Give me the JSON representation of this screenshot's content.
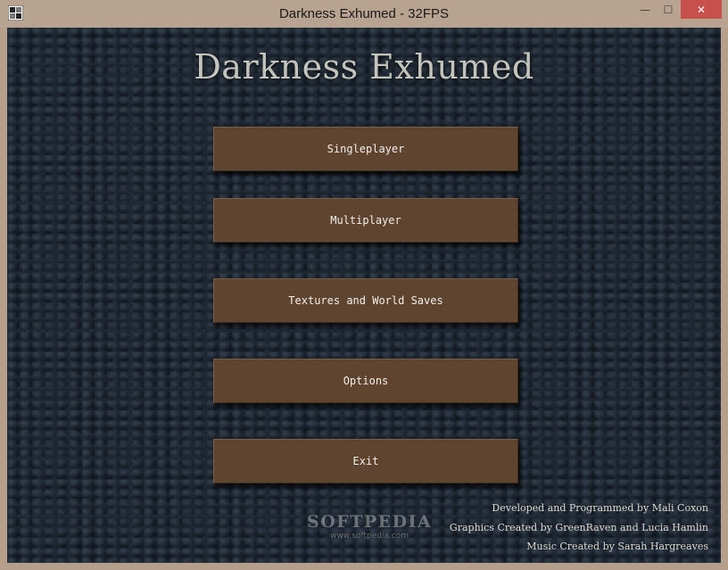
{
  "window": {
    "title": "Darkness Exhumed - 32FPS",
    "minimize_glyph": "—",
    "maximize_glyph": "☐",
    "close_glyph": "✕"
  },
  "game": {
    "title": "Darkness Exhumed"
  },
  "menu": {
    "items": [
      {
        "label": "Singleplayer"
      },
      {
        "label": "Multiplayer"
      },
      {
        "label": "Textures and World Saves"
      },
      {
        "label": "Options"
      },
      {
        "label": "Exit"
      }
    ]
  },
  "credits": {
    "developer": "Developed and Programmed by Mali Coxon",
    "graphics": "Graphics Created by GreenRaven and Lucia Hamlin",
    "music": "Music Created by Sarah Hargreaves"
  },
  "watermark": {
    "brand": "SOFTPEDIA",
    "url": "www.softpedia.com"
  },
  "colors": {
    "button_fill": "#5f4430",
    "title_text": "#c4c4bd",
    "close_button": "#c7504d"
  },
  "icons": {
    "app": "window-app-icon",
    "minimize": "minimize-icon",
    "maximize": "maximize-icon",
    "close": "close-icon"
  }
}
